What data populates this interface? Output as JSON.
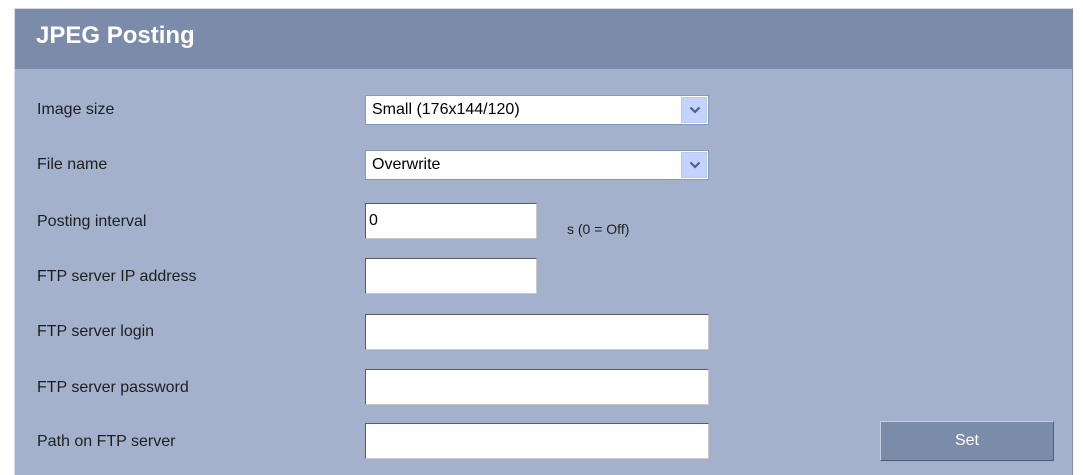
{
  "panel": {
    "title": "JPEG Posting"
  },
  "form": {
    "image_size": {
      "label": "Image size",
      "selected": "Small (176x144/120)"
    },
    "file_name": {
      "label": "File name",
      "selected": "Overwrite"
    },
    "posting_interval": {
      "label": "Posting interval",
      "value": "0",
      "unit": "s (0 = Off)"
    },
    "ftp_ip": {
      "label": "FTP server IP address",
      "value": ""
    },
    "ftp_login": {
      "label": "FTP server login",
      "value": ""
    },
    "ftp_password": {
      "label": "FTP server password",
      "value": ""
    },
    "ftp_path": {
      "label": "Path on FTP server",
      "value": ""
    }
  },
  "actions": {
    "set_label": "Set"
  },
  "icons": {
    "dropdown": "chevron-down-icon"
  },
  "colors": {
    "panel_bg": "#a4b1cc",
    "header_bg": "#7b8baa",
    "title_text": "#ffffff",
    "button_bg": "#7b8baa",
    "dropdown_btn": "#c3d3fd"
  }
}
